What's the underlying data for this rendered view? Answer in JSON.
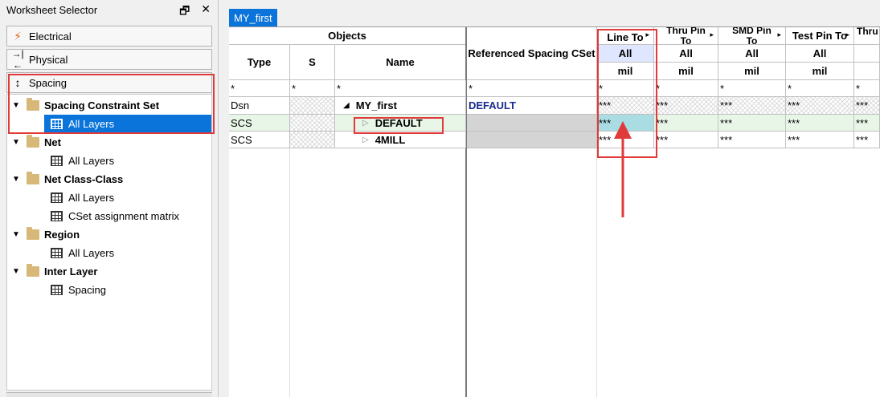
{
  "left": {
    "title": "Worksheet Selector",
    "restore_glyph": "🗗",
    "close_glyph": "✕",
    "categories": [
      {
        "label": "Electrical",
        "icon": "lightning-icon"
      },
      {
        "label": "Physical",
        "icon": "physical-arrows-icon"
      },
      {
        "label": "Spacing",
        "icon": "spacing-arrows-icon"
      }
    ],
    "tree": [
      {
        "label": "Spacing Constraint Set",
        "type": "folder"
      },
      {
        "label": "All Layers",
        "type": "sheet",
        "selected": true
      },
      {
        "label": "Net",
        "type": "folder"
      },
      {
        "label": "All Layers",
        "type": "sheet"
      },
      {
        "label": "Net Class-Class",
        "type": "folder"
      },
      {
        "label": "All Layers",
        "type": "sheet"
      },
      {
        "label": "CSet assignment matrix",
        "type": "sheet"
      },
      {
        "label": "Region",
        "type": "folder"
      },
      {
        "label": "All Layers",
        "type": "sheet"
      },
      {
        "label": "Inter Layer",
        "type": "folder"
      },
      {
        "label": "Spacing",
        "type": "sheet"
      }
    ]
  },
  "tab": {
    "label": "MY_first"
  },
  "table": {
    "objects_header": "Objects",
    "col_type": "Type",
    "col_s": "S",
    "col_name": "Name",
    "col_ref": "Referenced Spacing CSet",
    "value_columns": [
      {
        "label": "Line To",
        "all": "All",
        "unit": "mil"
      },
      {
        "label": "Thru Pin To",
        "all": "All",
        "unit": "mil"
      },
      {
        "label": "SMD Pin To",
        "all": "All",
        "unit": "mil"
      },
      {
        "label": "Test Pin To",
        "all": "All",
        "unit": "mil"
      },
      {
        "label": "Thru",
        "all": "",
        "unit": ""
      }
    ],
    "filter": "*",
    "rows": [
      {
        "type": "Dsn",
        "name": "MY_first",
        "ref": "DEFAULT",
        "values": [
          "***",
          "***",
          "***",
          "***",
          "***"
        ]
      },
      {
        "type": "SCS",
        "name": "DEFAULT",
        "ref": "",
        "values": [
          "***",
          "***",
          "***",
          "***",
          "***"
        ]
      },
      {
        "type": "SCS",
        "name": "4MILL",
        "ref": "",
        "values": [
          "***",
          "***",
          "***",
          "***",
          "***"
        ]
      }
    ]
  },
  "colors": {
    "accent": "#0a74da",
    "highlight_box": "#e03a3a",
    "all_row": "#dfe6ff",
    "selected_cell": "#a9dce3"
  }
}
